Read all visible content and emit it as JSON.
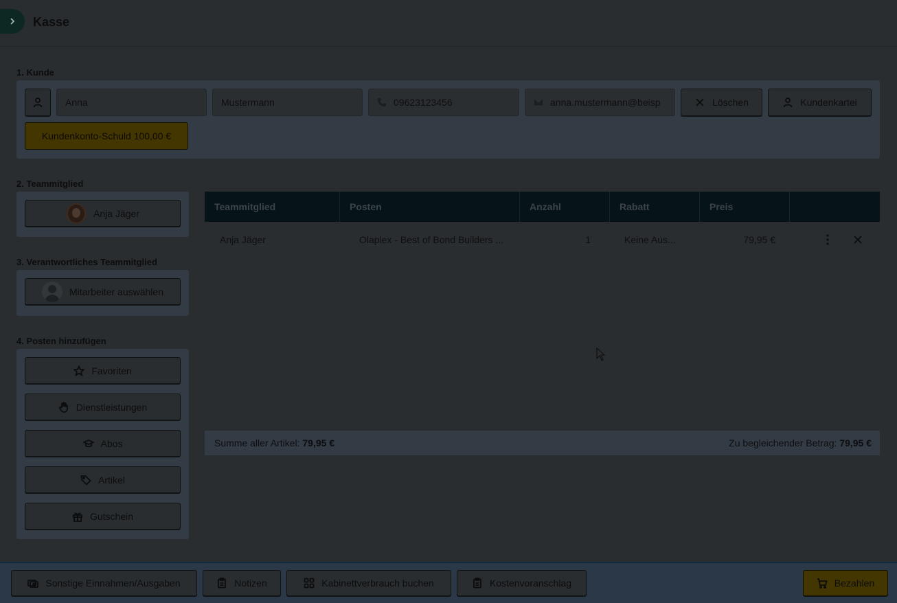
{
  "header": {
    "title": "Kasse"
  },
  "customer": {
    "section_label": "1. Kunde",
    "first_name": "Anna",
    "last_name": "Mustermann",
    "phone": "09623123456",
    "email": "anna.mustermann@beisp",
    "clear_label": "Löschen",
    "card_label": "Kundenkartei",
    "debt_label": "Kundenkonto-Schuld 100,00 €"
  },
  "team": {
    "section_label": "2. Teammitglied",
    "member_name": "Anja Jäger"
  },
  "responsible": {
    "section_label": "3. Verantwortliches Teammitglied",
    "select_label": "Mitarbeiter auswählen"
  },
  "add_items": {
    "section_label": "4. Posten hinzufügen",
    "buttons": [
      {
        "label": "Favoriten",
        "icon": "star-icon"
      },
      {
        "label": "Dienstleistungen",
        "icon": "hand-icon"
      },
      {
        "label": "Abos",
        "icon": "graduation-cap-icon"
      },
      {
        "label": "Artikel",
        "icon": "tag-icon"
      },
      {
        "label": "Gutschein",
        "icon": "gift-icon"
      }
    ]
  },
  "table": {
    "columns": [
      "Teammitglied",
      "Posten",
      "Anzahl",
      "Rabatt",
      "Preis"
    ],
    "rows": [
      {
        "member": "Anja Jäger",
        "item": "Olaplex - Best of Bond Builders ...",
        "qty": "1",
        "discount": "Keine Aus...",
        "price": "79,95 €"
      }
    ],
    "sum_label": "Summe aller Artikel:",
    "sum_value": "79,95 €",
    "due_label": "Zu begleichender Betrag:",
    "due_value": "79,95 €"
  },
  "bottom": {
    "other_label": "Sonstige Einnahmen/Ausgaben",
    "notes_label": "Notizen",
    "cabinet_label": "Kabinettverbrauch buchen",
    "estimate_label": "Kostenvoranschlag",
    "pay_label": "Bezahlen"
  }
}
